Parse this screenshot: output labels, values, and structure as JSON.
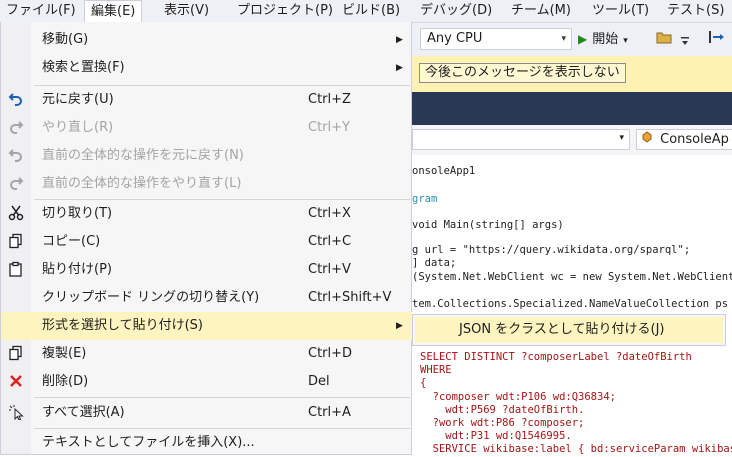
{
  "menubar": {
    "items": [
      {
        "label": "ファイル(F)"
      },
      {
        "label": "編集(E)"
      },
      {
        "label": "表示(V)"
      },
      {
        "label": "プロジェクト(P)"
      },
      {
        "label": "ビルド(B)"
      },
      {
        "label": "デバッグ(D)"
      },
      {
        "label": "チーム(M)"
      },
      {
        "label": "ツール(T)"
      },
      {
        "label": "テスト(S)"
      }
    ],
    "active_index": 1
  },
  "toolbar": {
    "platform_value": "Any CPU",
    "start_label": "開始",
    "play_icon": "▶",
    "dropdown_icon": "▾"
  },
  "infobar": {
    "button_label": "今後このメッセージを表示しない"
  },
  "navbar": {
    "class_combo_text": "ConsoleAp"
  },
  "code": {
    "lines": [
      "onsoleApp1",
      "gram",
      "void Main(string[] args)",
      "g url = \"https://query.wikidata.org/sparql\";",
      "] data;",
      "(System.Net.WebClient wc = new System.Net.WebClient",
      "tem.Collections.Specialized.NameValueCollection ps =",
      "SELECT DISTINCT ?composerLabel ?dateOfBirth",
      "WHERE",
      "{",
      "  ?composer wdt:P106 wd:Q36834;",
      "    wdt:P569 ?dateOfBirth.",
      "  ?work wdt:P86 ?composer;",
      "    wdt:P31 wd:Q1546995.",
      "  SERVICE wikibase:label { bd:serviceParam wikibase"
    ]
  },
  "edit_menu": {
    "items": [
      {
        "label": "移動(G)",
        "shortcut": "",
        "icon": "",
        "submenu": true,
        "disabled": false
      },
      {
        "label": "検索と置換(F)",
        "shortcut": "",
        "icon": "",
        "submenu": true,
        "disabled": false
      },
      {
        "label": "元に戻す(U)",
        "shortcut": "Ctrl+Z",
        "icon": "undo-icon",
        "submenu": false,
        "disabled": false
      },
      {
        "label": "やり直し(R)",
        "shortcut": "Ctrl+Y",
        "icon": "redo-icon",
        "submenu": false,
        "disabled": true
      },
      {
        "label": "直前の全体的な操作を元に戻す(N)",
        "shortcut": "",
        "icon": "global-undo-icon",
        "submenu": false,
        "disabled": true
      },
      {
        "label": "直前の全体的な操作をやり直す(L)",
        "shortcut": "",
        "icon": "global-redo-icon",
        "submenu": false,
        "disabled": true
      },
      {
        "label": "切り取り(T)",
        "shortcut": "Ctrl+X",
        "icon": "cut-icon",
        "submenu": false,
        "disabled": false
      },
      {
        "label": "コピー(C)",
        "shortcut": "Ctrl+C",
        "icon": "copy-icon",
        "submenu": false,
        "disabled": false
      },
      {
        "label": "貼り付け(P)",
        "shortcut": "Ctrl+V",
        "icon": "paste-icon",
        "submenu": false,
        "disabled": false
      },
      {
        "label": "クリップボード リングの切り替え(Y)",
        "shortcut": "Ctrl+Shift+V",
        "icon": "",
        "submenu": false,
        "disabled": false
      },
      {
        "label": "形式を選択して貼り付け(S)",
        "shortcut": "",
        "icon": "",
        "submenu": true,
        "disabled": false,
        "highlighted": true
      },
      {
        "label": "複製(E)",
        "shortcut": "Ctrl+D",
        "icon": "duplicate-icon",
        "submenu": false,
        "disabled": false
      },
      {
        "label": "削除(D)",
        "shortcut": "Del",
        "icon": "delete-icon",
        "submenu": false,
        "disabled": false
      },
      {
        "label": "すべて選択(A)",
        "shortcut": "Ctrl+A",
        "icon": "select-all-icon",
        "submenu": false,
        "disabled": false
      },
      {
        "label": "テキストとしてファイルを挿入(X)...",
        "shortcut": "",
        "icon": "",
        "submenu": false,
        "disabled": false
      }
    ]
  },
  "paste_special_submenu": {
    "items": [
      {
        "label": "JSON をクラスとして貼り付ける(J)"
      }
    ]
  },
  "colors": {
    "menu_highlight": "#fdf4bf",
    "infobar": "#fdf2b1",
    "tabstrip": "#293955",
    "undo_blue": "#1e5fb4",
    "delete_red": "#d9231d"
  }
}
